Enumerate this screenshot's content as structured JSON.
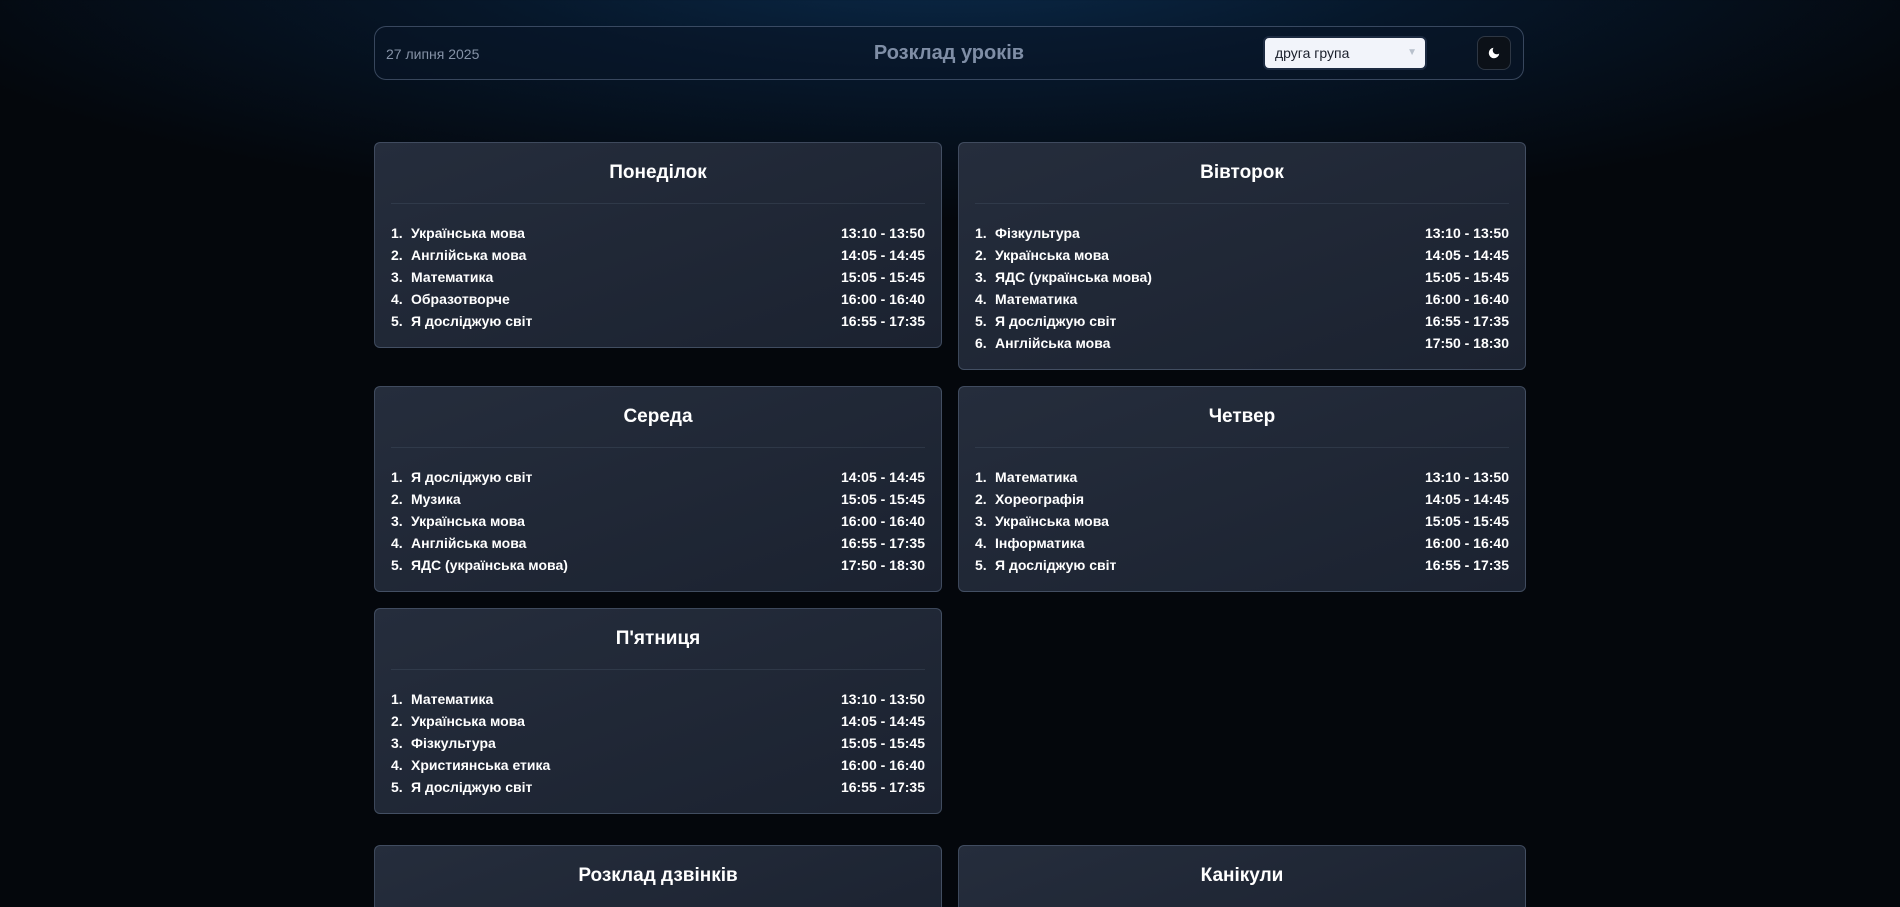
{
  "header": {
    "date": "27 липня 2025",
    "title": "Розклад уроків",
    "group_selected": "друга група",
    "theme_toggle_icon": "moon-icon"
  },
  "days": {
    "monday": {
      "title": "Понеділок",
      "lessons": [
        {
          "num": "1.",
          "name": "Українська мова",
          "time": "13:10 - 13:50"
        },
        {
          "num": "2.",
          "name": "Англійська мова",
          "time": "14:05 - 14:45"
        },
        {
          "num": "3.",
          "name": "Математика",
          "time": "15:05 - 15:45"
        },
        {
          "num": "4.",
          "name": "Образотворче",
          "time": "16:00 - 16:40"
        },
        {
          "num": "5.",
          "name": "Я досліджую світ",
          "time": "16:55 - 17:35"
        }
      ]
    },
    "tuesday": {
      "title": "Вівторок",
      "lessons": [
        {
          "num": "1.",
          "name": "Фізкультура",
          "time": "13:10 - 13:50"
        },
        {
          "num": "2.",
          "name": "Українська мова",
          "time": "14:05 - 14:45"
        },
        {
          "num": "3.",
          "name": "ЯДС (українська мова)",
          "time": "15:05 - 15:45"
        },
        {
          "num": "4.",
          "name": "Математика",
          "time": "16:00 - 16:40"
        },
        {
          "num": "5.",
          "name": "Я досліджую світ",
          "time": "16:55 - 17:35"
        },
        {
          "num": "6.",
          "name": "Англійська мова",
          "time": "17:50 - 18:30"
        }
      ]
    },
    "wednesday": {
      "title": "Середа",
      "lessons": [
        {
          "num": "1.",
          "name": "Я досліджую світ",
          "time": "14:05 - 14:45"
        },
        {
          "num": "2.",
          "name": "Музика",
          "time": "15:05 - 15:45"
        },
        {
          "num": "3.",
          "name": "Українська мова",
          "time": "16:00 - 16:40"
        },
        {
          "num": "4.",
          "name": "Англійська мова",
          "time": "16:55 - 17:35"
        },
        {
          "num": "5.",
          "name": "ЯДС (українська мова)",
          "time": "17:50 - 18:30"
        }
      ]
    },
    "thursday": {
      "title": "Четвер",
      "lessons": [
        {
          "num": "1.",
          "name": "Математика",
          "time": "13:10 - 13:50"
        },
        {
          "num": "2.",
          "name": "Хореографія",
          "time": "14:05 - 14:45"
        },
        {
          "num": "3.",
          "name": "Українська мова",
          "time": "15:05 - 15:45"
        },
        {
          "num": "4.",
          "name": "Інформатика",
          "time": "16:00 - 16:40"
        },
        {
          "num": "5.",
          "name": "Я досліджую світ",
          "time": "16:55 - 17:35"
        }
      ]
    },
    "friday": {
      "title": "П'ятниця",
      "lessons": [
        {
          "num": "1.",
          "name": "Математика",
          "time": "13:10 - 13:50"
        },
        {
          "num": "2.",
          "name": "Українська мова",
          "time": "14:05 - 14:45"
        },
        {
          "num": "3.",
          "name": "Фізкультура",
          "time": "15:05 - 15:45"
        },
        {
          "num": "4.",
          "name": "Християнська етика",
          "time": "16:00 - 16:40"
        },
        {
          "num": "5.",
          "name": "Я досліджую світ",
          "time": "16:55 - 17:35"
        }
      ]
    }
  },
  "bells": {
    "title": "Розклад дзвінків"
  },
  "holidays": {
    "title": "Канікули"
  }
}
